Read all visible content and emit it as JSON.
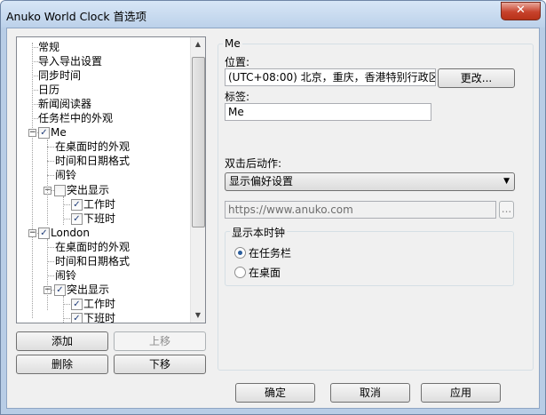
{
  "window": {
    "title": "Anuko World Clock 首选项",
    "close_glyph": "✕"
  },
  "tree": {
    "items": [
      {
        "label": "常规"
      },
      {
        "label": "导入导出设置"
      },
      {
        "label": "同步时间"
      },
      {
        "label": "日历"
      },
      {
        "label": "新闻阅读器"
      },
      {
        "label": "任务栏中的外观"
      },
      {
        "label": "Me",
        "checked": true,
        "expander": "−"
      },
      {
        "label": "在桌面时的外观"
      },
      {
        "label": "时间和日期格式"
      },
      {
        "label": "闹铃"
      },
      {
        "label": "突出显示",
        "checked": false,
        "expander": "−"
      },
      {
        "label": "工作时",
        "checked": true
      },
      {
        "label": "下班时",
        "checked": true
      },
      {
        "label": "London",
        "checked": true,
        "expander": "−"
      },
      {
        "label": "在桌面时的外观"
      },
      {
        "label": "时间和日期格式"
      },
      {
        "label": "闹铃"
      },
      {
        "label": "突出显示",
        "checked": true,
        "expander": "−"
      },
      {
        "label": "工作时",
        "checked": true
      },
      {
        "label": "下班时",
        "checked": true
      }
    ],
    "check_glyph": "✓"
  },
  "left_buttons": {
    "add": "添加",
    "move_up": "上移",
    "delete": "删除",
    "move_down": "下移"
  },
  "clock_panel": {
    "group_title": "Me",
    "location_label": "位置:",
    "location_value": "(UTC+08:00) 北京，重庆，香港特别行政区，",
    "change_button": "更改...",
    "tag_label": "标签:",
    "tag_value": "Me",
    "double_click_label": "双击后动作:",
    "double_click_value": "显示偏好设置",
    "url_placeholder": "https://www.anuko.com",
    "browse_button": "...",
    "show_clock_group": "显示本时钟",
    "radio_taskbar": "在任务栏",
    "radio_desktop": "在桌面",
    "selected": "taskbar"
  },
  "footer": {
    "ok": "确定",
    "cancel": "取消",
    "apply": "应用"
  }
}
